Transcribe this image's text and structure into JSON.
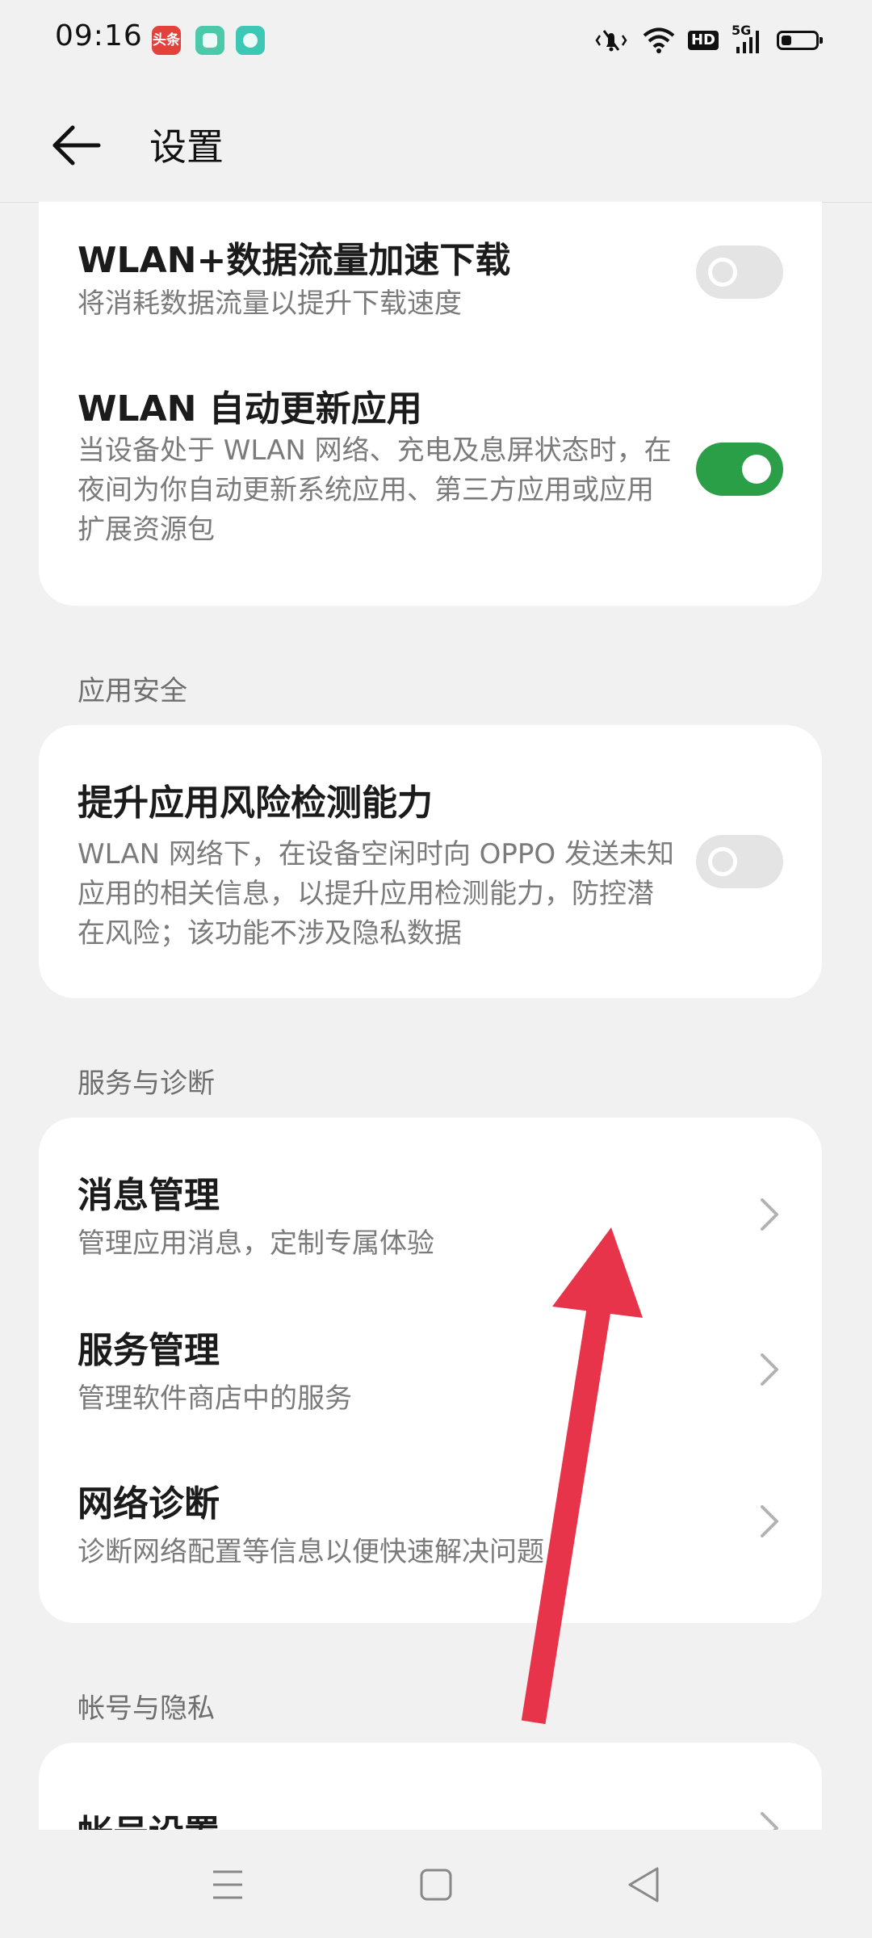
{
  "status_bar": {
    "time": "09:16",
    "notification_icons": [
      "toutiao-icon",
      "green-app-icon",
      "green-chat-icon"
    ],
    "toutiao_label": "头条",
    "hd_badge": "HD",
    "network": "5G",
    "battery_level": 0.3
  },
  "header": {
    "back_icon": "arrow-left-icon",
    "title": "设置"
  },
  "download_card": {
    "items": [
      {
        "title": "WLAN+数据流量加速下载",
        "desc": "将消耗数据流量以提升下载速度",
        "toggle": "off"
      },
      {
        "title": "WLAN 自动更新应用",
        "desc": "当设备处于 WLAN 网络、充电及息屏状态时，在夜间为你自动更新系统应用、第三方应用或应用扩展资源包",
        "toggle": "on"
      }
    ]
  },
  "app_security": {
    "label": "应用安全",
    "items": [
      {
        "title": "提升应用风险检测能力",
        "desc": "WLAN 网络下，在设备空闲时向 OPPO 发送未知应用的相关信息，以提升应用检测能力，防控潜在风险；该功能不涉及隐私数据",
        "toggle": "off"
      }
    ]
  },
  "service_diagnosis": {
    "label": "服务与诊断",
    "items": [
      {
        "title": "消息管理",
        "desc": "管理应用消息，定制专属体验"
      },
      {
        "title": "服务管理",
        "desc": "管理软件商店中的服务"
      },
      {
        "title": "网络诊断",
        "desc": "诊断网络配置等信息以便快速解决问题"
      }
    ]
  },
  "account_privacy": {
    "label": "帐号与隐私",
    "items": [
      {
        "title": "帐号设置"
      }
    ]
  },
  "annotation": {
    "color": "#e8344a"
  },
  "nav_bar": {
    "icons": [
      "menu-icon",
      "home-square-icon",
      "back-triangle-icon"
    ]
  },
  "colors": {
    "toggle_on": "#2b9e48",
    "toggle_off": "#e4e4e4",
    "background": "#f1f1f1"
  }
}
